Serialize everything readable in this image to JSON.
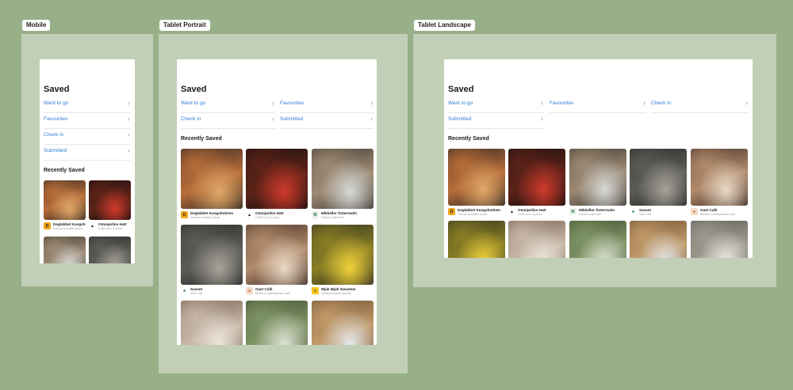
{
  "frames": [
    {
      "label": "Mobile"
    },
    {
      "label": "Tablet Portrait"
    },
    {
      "label": "Tablet Landscape"
    }
  ],
  "screen": {
    "title": "Saved",
    "section_title": "Recently Saved",
    "lists": [
      "Want to go",
      "Favourites",
      "Check in",
      "Submitted"
    ]
  },
  "icons": {
    "chevron": "›"
  },
  "places": [
    {
      "name": "Deglabbet Kungsholmen",
      "sub": "Casual woodfire pizza",
      "logo_bg": "#f1a417",
      "logo_fg": "#222",
      "logo_glyph": "D",
      "logo_icon": "pizza-logo-icon",
      "palette": [
        "#2b2521",
        "#b86d39",
        "#e0a867"
      ]
    },
    {
      "name": "Omnipollos Hatt",
      "sub": "Craft beer & pizza",
      "logo_bg": "#ffffff",
      "logo_fg": "#111",
      "logo_glyph": "▲",
      "logo_icon": "witch-hat-logo-icon",
      "palette": [
        "#170f0e",
        "#5c2318",
        "#d03a2c"
      ]
    },
    {
      "name": "Mikkeller Östermalm",
      "sub": "Danish craft beer",
      "logo_bg": "#e8f1ec",
      "logo_fg": "#2f7a4b",
      "logo_glyph": "M",
      "logo_icon": "mikkeller-logo-icon",
      "palette": [
        "#3d3630",
        "#9e8a73",
        "#d6d9d8"
      ]
    },
    {
      "name": "Savant",
      "sub": "Wine bar",
      "logo_bg": "#ffffff",
      "logo_fg": "#2f7a4b",
      "logo_glyph": "♣",
      "logo_icon": "leaf-logo-icon",
      "palette": [
        "#262624",
        "#5d5c57",
        "#a7a39b"
      ]
    },
    {
      "name": "Gast Café",
      "sub": "Modern scandinavian cafe",
      "logo_bg": "#f6d8c4",
      "logo_fg": "#a2593a",
      "logo_glyph": "●",
      "logo_icon": "gast-logo-icon",
      "palette": [
        "#3b2a22",
        "#b38b6b",
        "#ead9c6"
      ]
    },
    {
      "name": "Mjuk Mjuk Vasastan",
      "sub": "Artisanal baked goods",
      "logo_bg": "#f3c51e",
      "logo_fg": "#222",
      "logo_glyph": "≡",
      "logo_icon": "mjuk-logo-icon",
      "palette": [
        "#2a2b22",
        "#8a7f24",
        "#f2d33a"
      ]
    },
    {
      "name": "",
      "sub": "",
      "logo_bg": "",
      "logo_fg": "",
      "logo_glyph": "",
      "logo_icon": "",
      "palette": [
        "#6e5a4a",
        "#c8b8a8",
        "#efe7de"
      ]
    },
    {
      "name": "",
      "sub": "",
      "logo_bg": "",
      "logo_fg": "",
      "logo_glyph": "",
      "logo_icon": "",
      "palette": [
        "#3e4a2e",
        "#7f9565",
        "#dfe4d7"
      ]
    },
    {
      "name": "",
      "sub": "",
      "logo_bg": "",
      "logo_fg": "",
      "logo_glyph": "",
      "logo_icon": "",
      "palette": [
        "#6b4a2f",
        "#c19a68",
        "#e5e9ec"
      ]
    },
    {
      "name": "",
      "sub": "",
      "logo_bg": "",
      "logo_fg": "",
      "logo_glyph": "",
      "logo_icon": "",
      "palette": [
        "#5a5650",
        "#9e9a8f",
        "#f0ede7"
      ]
    }
  ]
}
